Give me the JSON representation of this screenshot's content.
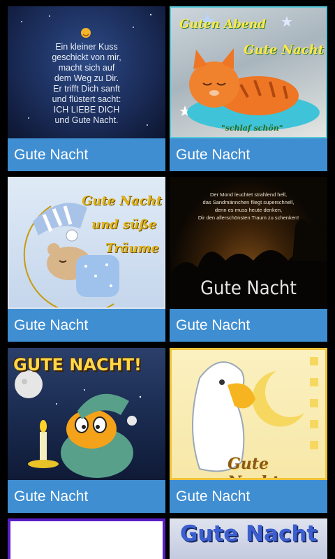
{
  "cards": [
    {
      "caption": "Gute Nacht",
      "image_text": [
        "Ein kleiner Kuss",
        "geschickt von mir,",
        "macht sich auf",
        "dem Weg zu Dir.",
        "Er trifft Dich sanft",
        "und flüstert sacht:",
        "ICH LIEBE DICH",
        "und Gute Nacht."
      ]
    },
    {
      "caption": "Gute Nacht",
      "image_text": [
        "Guten Abend",
        "Gute Nacht",
        "\"schlaf schön\""
      ]
    },
    {
      "caption": "Gute Nacht",
      "image_text": [
        "Gute Nacht",
        "und süße",
        "Träume"
      ]
    },
    {
      "caption": "Gute Nacht",
      "image_text": [
        "Der Mond leuchtet strahlend hell,",
        "das Sandmännchen fliegt superschnell,",
        "denn es muss heute denken,",
        "Dir den allerschönsten Traum zu schenken!",
        "Gute Nacht"
      ]
    },
    {
      "caption": "Gute Nacht",
      "image_text": [
        "GUTE NACHT!"
      ]
    },
    {
      "caption": "Gute Nacht",
      "image_text": [
        "Gute Nacht"
      ]
    },
    {
      "caption": "",
      "image_text": []
    },
    {
      "caption": "",
      "image_text": [
        "Gute Nacht"
      ]
    }
  ],
  "colors": {
    "caption_bg": "#3f8ed2",
    "caption_text": "#ffffff",
    "page_bg": "#000000"
  }
}
